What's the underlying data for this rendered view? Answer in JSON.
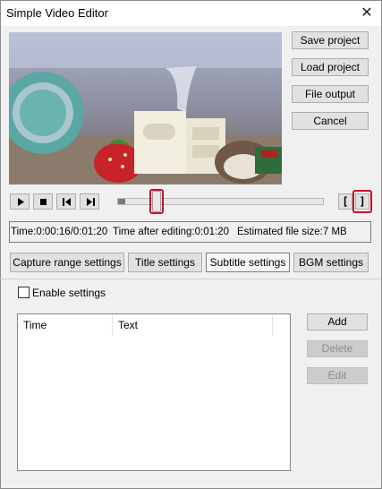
{
  "window": {
    "title": "Simple Video Editor",
    "close_glyph": "✕"
  },
  "side_buttons": {
    "save_project": "Save project",
    "load_project": "Load project",
    "file_output": "File output",
    "cancel": "Cancel"
  },
  "playback": {
    "controls": [
      "play-icon",
      "stop-icon",
      "step-back-icon",
      "step-forward-icon"
    ],
    "seek_position_fraction": 0.19,
    "range_start_label": "[",
    "range_end_label": "]"
  },
  "status": {
    "time": "Time:0:00:16/0:01:20",
    "time_after_editing": "Time after editing:0:01:20",
    "estimated_size": "Estimated file size:7 MB"
  },
  "tabs": [
    {
      "label": "Capture range settings"
    },
    {
      "label": "Title settings"
    },
    {
      "label": "Subtitle settings",
      "active": true
    },
    {
      "label": "BGM settings"
    }
  ],
  "subtitle_panel": {
    "enable_label": "Enable settings",
    "enable_checked": false,
    "columns": [
      "Time",
      "Text"
    ],
    "rows": [],
    "add_label": "Add",
    "delete_label": "Delete",
    "edit_label": "Edit"
  },
  "colors": {
    "highlight": "#c8102e"
  }
}
